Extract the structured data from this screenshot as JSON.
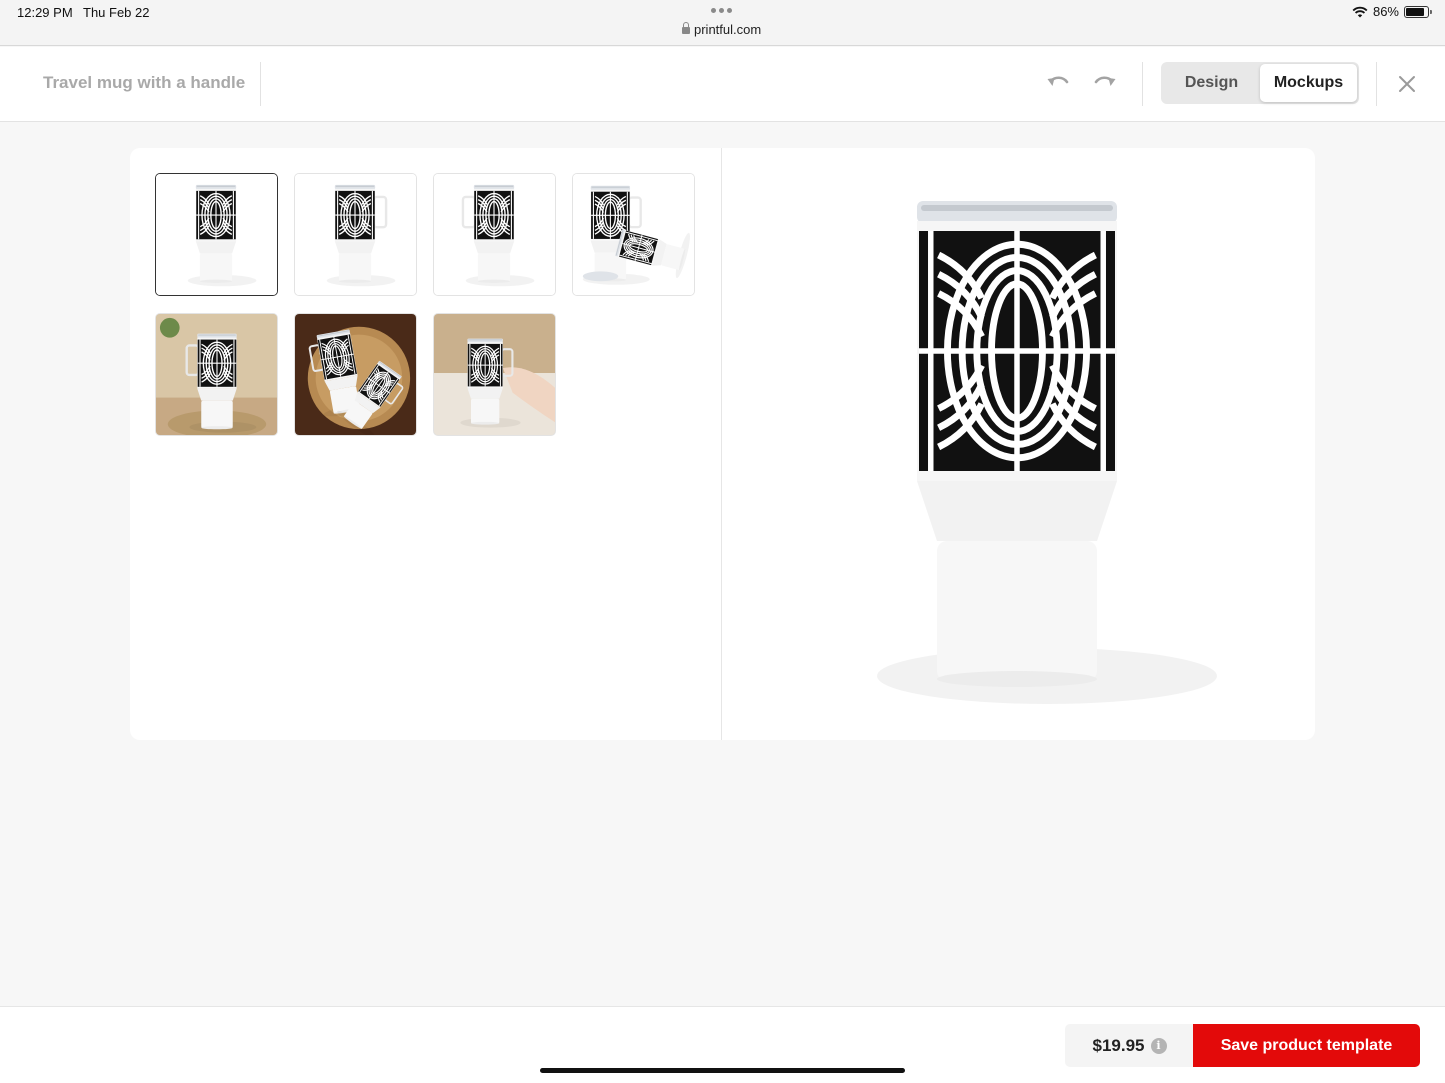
{
  "status_bar": {
    "time": "12:29 PM",
    "date": "Thu Feb 22",
    "url": "printful.com",
    "battery": "86%",
    "battery_level": 0.86
  },
  "header": {
    "product_title": "Travel mug with a handle",
    "undo_icon": "undo-icon",
    "redo_icon": "redo-icon",
    "tabs": [
      {
        "label": "Design",
        "active": false
      },
      {
        "label": "Mockups",
        "active": true
      }
    ],
    "close_icon": "close-icon"
  },
  "mockups": {
    "thumbnails": [
      {
        "name": "mug-front-view",
        "scene": "studio",
        "handle": "none",
        "selected": true
      },
      {
        "name": "mug-right-view",
        "scene": "studio",
        "handle": "right",
        "selected": false
      },
      {
        "name": "mug-left-view",
        "scene": "studio",
        "handle": "left",
        "selected": false
      },
      {
        "name": "mug-with-lid-off",
        "scene": "studio-lid",
        "handle": "right",
        "selected": false
      },
      {
        "name": "mug-kitchen-lifestyle",
        "scene": "kitchen",
        "handle": "left",
        "selected": false
      },
      {
        "name": "mug-tray-flatlay",
        "scene": "tray",
        "handle": "left",
        "selected": false
      },
      {
        "name": "mug-in-hand",
        "scene": "hand",
        "handle": "right",
        "selected": false
      }
    ],
    "preview": {
      "name": "mug-front-view-large"
    }
  },
  "footer": {
    "price": "$19.95",
    "info_icon": "info-icon",
    "info_glyph": "i",
    "save_label": "Save product template"
  },
  "colors": {
    "accent": "#e30a0a",
    "pattern_dark": "#111111",
    "pattern_light": "#ffffff"
  }
}
